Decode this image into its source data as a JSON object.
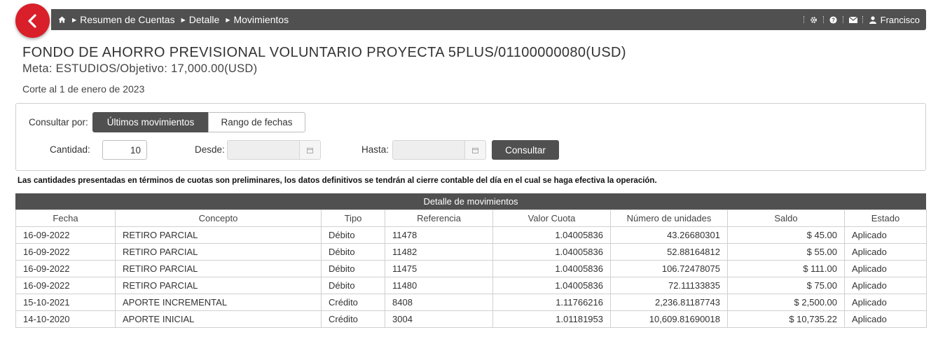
{
  "breadcrumb": {
    "items": [
      "Resumen de Cuentas",
      "Detalle",
      "Movimientos"
    ]
  },
  "topbar": {
    "user_name": "Francisco"
  },
  "header": {
    "title": "FONDO DE AHORRO PREVISIONAL VOLUNTARIO PROYECTA 5PLUS/01100000080(USD)",
    "subtitle": "Meta: ESTUDIOS/Objetivo: 17,000.00(USD)",
    "corte": "Corte al 1 de enero de 2023"
  },
  "filters": {
    "consultar_por_label": "Consultar por:",
    "tab_ultimos": "Últimos movimientos",
    "tab_rango": "Rango de fechas",
    "cantidad_label": "Cantidad:",
    "cantidad_value": "10",
    "desde_label": "Desde:",
    "hasta_label": "Hasta:",
    "consultar_button": "Consultar"
  },
  "notice": "Las cantidades presentadas en términos de cuotas son preliminares, los datos definitivos se tendrán al cierre contable del día en el cual se haga efectiva la operación.",
  "table": {
    "caption": "Detalle de movimientos",
    "headers": [
      "Fecha",
      "Concepto",
      "Tipo",
      "Referencia",
      "Valor Cuota",
      "Número de unidades",
      "Saldo",
      "Estado"
    ],
    "rows": [
      [
        "16-09-2022",
        "RETIRO PARCIAL",
        "Débito",
        "11478",
        "1.04005836",
        "43.26680301",
        "$ 45.00",
        "Aplicado"
      ],
      [
        "16-09-2022",
        "RETIRO PARCIAL",
        "Débito",
        "11482",
        "1.04005836",
        "52.88164812",
        "$ 55.00",
        "Aplicado"
      ],
      [
        "16-09-2022",
        "RETIRO PARCIAL",
        "Débito",
        "11475",
        "1.04005836",
        "106.72478075",
        "$ 111.00",
        "Aplicado"
      ],
      [
        "16-09-2022",
        "RETIRO PARCIAL",
        "Débito",
        "11480",
        "1.04005836",
        "72.11133835",
        "$ 75.00",
        "Aplicado"
      ],
      [
        "15-10-2021",
        "APORTE INCREMENTAL",
        "Crédito",
        "8408",
        "1.11766216",
        "2,236.81187743",
        "$ 2,500.00",
        "Aplicado"
      ],
      [
        "14-10-2020",
        "APORTE INICIAL",
        "Crédito",
        "3004",
        "1.01181953",
        "10,609.81690018",
        "$ 10,735.22",
        "Aplicado"
      ]
    ]
  },
  "colors": {
    "accent_red": "#d81f2a",
    "bar_gray": "#505050"
  },
  "icons": {
    "back": "chevron-left-icon",
    "home": "home-icon",
    "settings": "gear-icon",
    "help": "question-icon",
    "mail": "envelope-icon",
    "user": "user-icon",
    "calendar": "calendar-icon"
  }
}
